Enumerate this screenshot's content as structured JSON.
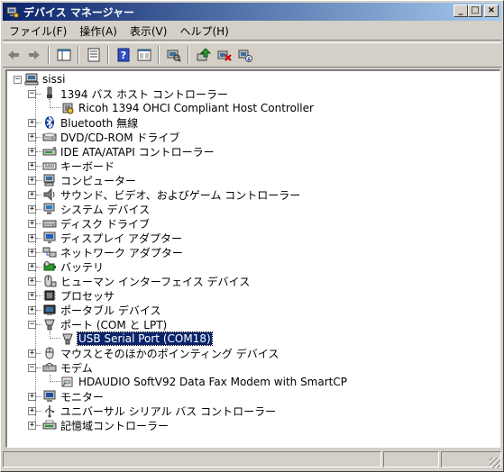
{
  "window": {
    "title": "デバイス マネージャー"
  },
  "menu": [
    "ファイル(F)",
    "操作(A)",
    "表示(V)",
    "ヘルプ(H)"
  ],
  "toolbar_icons": [
    "back-arrow-icon",
    "forward-arrow-icon",
    "console-tree-icon",
    "properties-icon",
    "help-icon",
    "view-icon",
    "scan-hardware-icon",
    "update-driver-icon",
    "uninstall-icon",
    "disable-icon"
  ],
  "tree": {
    "root": "sissi",
    "nodes": [
      {
        "label": "1394 バス ホスト コントローラー",
        "expanded": true,
        "icon": "firewire"
      },
      {
        "label": "Ricoh 1394 OHCI Compliant Host Controller",
        "child": true,
        "icon": "chip"
      },
      {
        "label": "Bluetooth 無線",
        "icon": "bluetooth"
      },
      {
        "label": "DVD/CD-ROM ドライブ",
        "icon": "cdrom"
      },
      {
        "label": "IDE ATA/ATAPI コントローラー",
        "icon": "ide"
      },
      {
        "label": "キーボード",
        "icon": "keyboard"
      },
      {
        "label": "コンピューター",
        "icon": "computer"
      },
      {
        "label": "サウンド、ビデオ、およびゲーム コントローラー",
        "icon": "sound"
      },
      {
        "label": "システム デバイス",
        "icon": "system"
      },
      {
        "label": "ディスク ドライブ",
        "icon": "disk"
      },
      {
        "label": "ディスプレイ アダプター",
        "icon": "display"
      },
      {
        "label": "ネットワーク アダプター",
        "icon": "network"
      },
      {
        "label": "バッテリ",
        "icon": "battery"
      },
      {
        "label": "ヒューマン インターフェイス デバイス",
        "icon": "hid"
      },
      {
        "label": "プロセッサ",
        "icon": "processor"
      },
      {
        "label": "ポータブル デバイス",
        "icon": "portable"
      },
      {
        "label": "ポート (COM と LPT)",
        "expanded": true,
        "icon": "port"
      },
      {
        "label": "USB Serial Port (COM18)",
        "child": true,
        "selected": true,
        "icon": "port"
      },
      {
        "label": "マウスとそのほかのポインティング デバイス",
        "icon": "mouse"
      },
      {
        "label": "モデム",
        "expanded": true,
        "icon": "modem"
      },
      {
        "label": "HDAUDIO SoftV92 Data Fax Modem with SmartCP",
        "child": true,
        "icon": "modemchild"
      },
      {
        "label": "モニター",
        "icon": "monitor"
      },
      {
        "label": "ユニバーサル シリアル バス コントローラー",
        "icon": "usb"
      },
      {
        "label": "記憶域コントローラー",
        "icon": "storage"
      }
    ]
  },
  "colors": {
    "selection": "#0a246a",
    "face": "#d4d0c8",
    "title_start": "#0a246a",
    "title_end": "#a6caf0"
  }
}
